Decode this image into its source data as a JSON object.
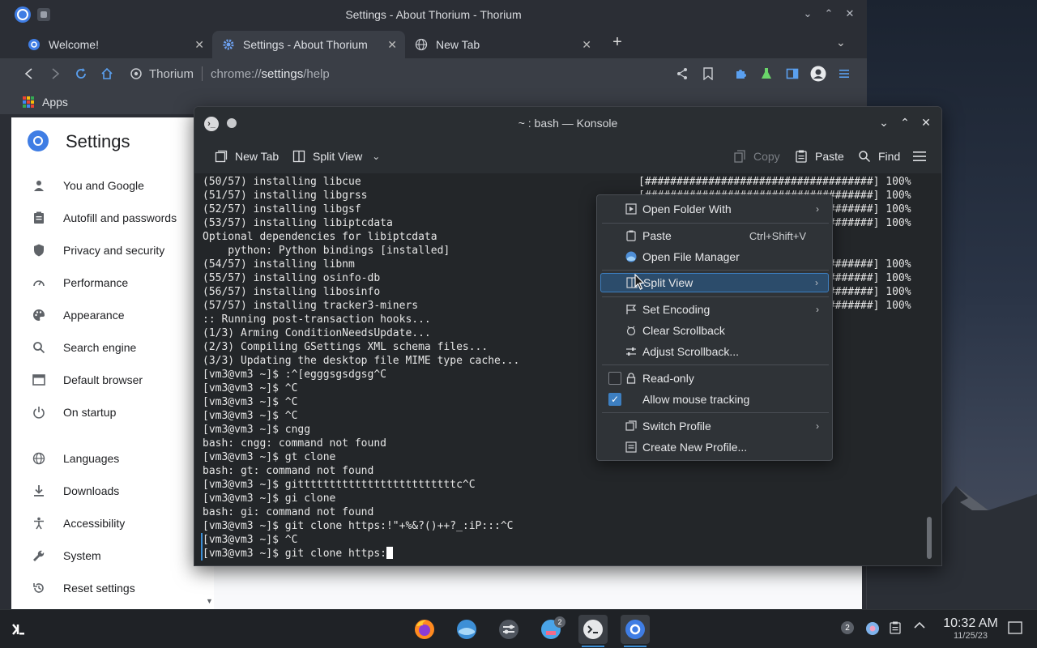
{
  "browser": {
    "window_title": "Settings - About Thorium - Thorium",
    "tabs": [
      {
        "label": "Welcome!"
      },
      {
        "label": "Settings - About Thorium"
      },
      {
        "label": "New Tab"
      }
    ],
    "omnibox": {
      "site": "Thorium",
      "url_prefix": "chrome://",
      "url_bold": "settings",
      "url_suffix": "/help"
    },
    "bookmarks": {
      "apps_label": "Apps"
    }
  },
  "settings": {
    "title": "Settings",
    "nav": [
      {
        "label": "You and Google",
        "icon": "person-icon"
      },
      {
        "label": "Autofill and passwords",
        "icon": "clipboard-icon"
      },
      {
        "label": "Privacy and security",
        "icon": "shield-icon"
      },
      {
        "label": "Performance",
        "icon": "speedometer-icon"
      },
      {
        "label": "Appearance",
        "icon": "palette-icon"
      },
      {
        "label": "Search engine",
        "icon": "search-icon"
      },
      {
        "label": "Default browser",
        "icon": "browser-icon"
      },
      {
        "label": "On startup",
        "icon": "power-icon"
      },
      {
        "label": "Languages",
        "icon": "globe-icon"
      },
      {
        "label": "Downloads",
        "icon": "download-icon"
      },
      {
        "label": "Accessibility",
        "icon": "accessibility-icon"
      },
      {
        "label": "System",
        "icon": "wrench-icon"
      },
      {
        "label": "Reset settings",
        "icon": "reset-icon"
      }
    ]
  },
  "konsole": {
    "window_title": "~ : bash — Konsole",
    "toolbar": {
      "new_tab": "New Tab",
      "split_view": "Split View",
      "copy": "Copy",
      "paste": "Paste",
      "find": "Find"
    },
    "lines": [
      "(50/57) installing libcue",
      "(51/57) installing libgrss",
      "(52/57) installing libgsf",
      "(53/57) installing libiptcdata",
      "Optional dependencies for libiptcdata",
      "    python: Python bindings [installed]",
      "(54/57) installing libnm",
      "(55/57) installing osinfo-db",
      "(56/57) installing libosinfo",
      "(57/57) installing tracker3-miners",
      ":: Running post-transaction hooks...",
      "(1/3) Arming ConditionNeedsUpdate...",
      "(2/3) Compiling GSettings XML schema files...",
      "(3/3) Updating the desktop file MIME type cache...",
      "[vm3@vm3 ~]$ :^[egggsgsdgsg^C",
      "[vm3@vm3 ~]$ ^C",
      "[vm3@vm3 ~]$ ^C",
      "[vm3@vm3 ~]$ ^C",
      "[vm3@vm3 ~]$ cngg",
      "bash: cngg: command not found",
      "[vm3@vm3 ~]$ gt clone",
      "bash: gt: command not found",
      "[vm3@vm3 ~]$ gitttttttttttttttttttttttttc^C",
      "[vm3@vm3 ~]$ gi clone",
      "bash: gi: command not found",
      "[vm3@vm3 ~]$ git clone https:!\"+%&?()++?_:iP:::^C",
      "[vm3@vm3 ~]$ ^C",
      "[vm3@vm3 ~]$ git clone https:"
    ],
    "progress": [
      {
        "row": 0,
        "text": "[####################################] 100%"
      },
      {
        "row": 1,
        "text": "[####################################] 100%"
      },
      {
        "row": 2,
        "text": "[####################################] 100%"
      },
      {
        "row": 3,
        "text": "[####################################] 100%"
      },
      {
        "row": 6,
        "text": "[####################################] 100%"
      },
      {
        "row": 7,
        "text": "[####################################] 100%"
      },
      {
        "row": 8,
        "text": "[####################################] 100%"
      },
      {
        "row": 9,
        "text": "[####################################] 100%"
      }
    ]
  },
  "context_menu": {
    "open_folder_with": "Open Folder With",
    "paste": "Paste",
    "paste_shortcut": "Ctrl+Shift+V",
    "open_file_manager": "Open File Manager",
    "split_view": "Split View",
    "set_encoding": "Set Encoding",
    "clear_scrollback": "Clear Scrollback",
    "adjust_scrollback": "Adjust Scrollback...",
    "read_only": "Read-only",
    "read_only_checked": false,
    "allow_mouse_tracking": "Allow mouse tracking",
    "allow_mouse_tracking_checked": true,
    "switch_profile": "Switch Profile",
    "create_new_profile": "Create New Profile..."
  },
  "taskbar": {
    "shop_badge": "2",
    "tray_badge": "2",
    "time": "10:32 AM",
    "date": "11/25/23"
  },
  "colors": {
    "accent": "#3d8fd6",
    "menu_highlight": "#2c4c6b",
    "thorium_blue": "#3f7de4"
  }
}
